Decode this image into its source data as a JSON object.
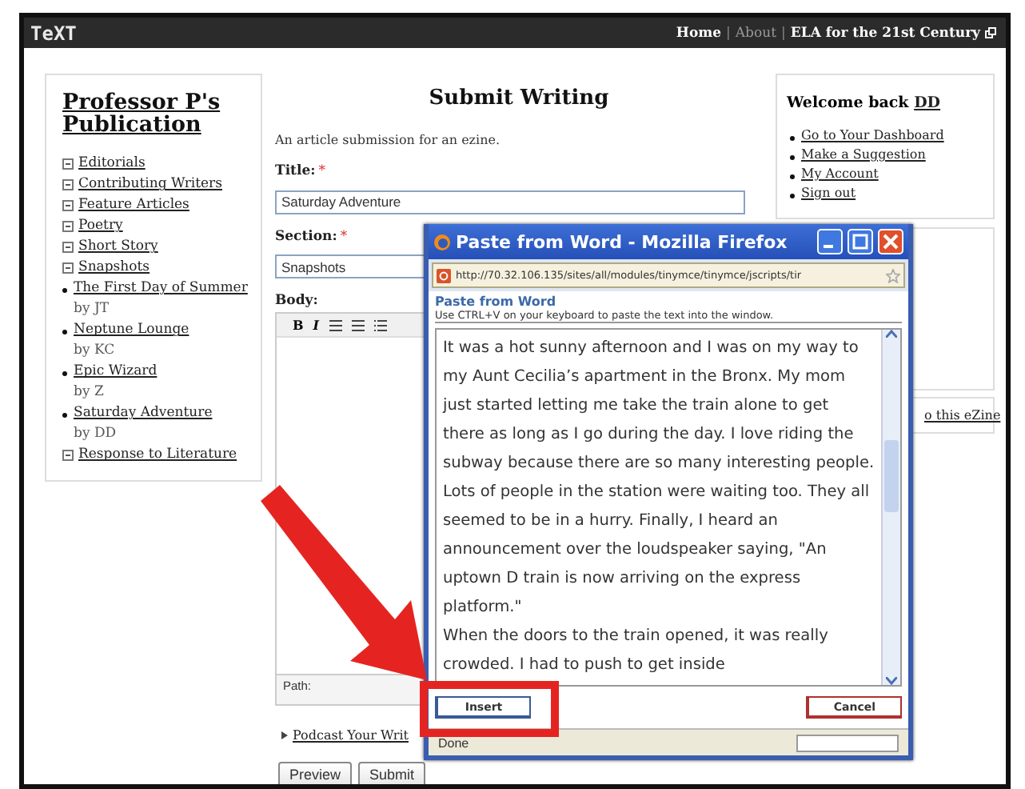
{
  "top_bar": {
    "logo": "TeXT",
    "separators": [
      "|",
      "|"
    ],
    "links": [
      {
        "label": "Home",
        "selected": false
      },
      {
        "label": "About",
        "selected": true
      },
      {
        "label": "ELA for the 21st Century",
        "selected": false,
        "external": true
      }
    ]
  },
  "left_panel": {
    "title": "Professor P's Publication",
    "items": [
      {
        "label": "Editorials"
      },
      {
        "label": "Contributing Writers"
      },
      {
        "label": "Feature Articles"
      },
      {
        "label": "Poetry"
      },
      {
        "label": "Short Story"
      },
      {
        "label": "Snapshots",
        "children": [
          {
            "label": "The First Day of Summer",
            "byline": "by JT"
          },
          {
            "label": "Neptune Lounge",
            "byline": "by KC"
          },
          {
            "label": "Epic Wizard",
            "byline": "by Z"
          },
          {
            "label": "Saturday Adventure",
            "byline": "by DD"
          }
        ]
      },
      {
        "label": "Response to Literature"
      }
    ]
  },
  "main": {
    "heading": "Submit Writing",
    "description": "An article submission for an ezine.",
    "fields": [
      {
        "label": "Title:",
        "required_mark": "*",
        "value": "Saturday Adventure"
      },
      {
        "label": "Section:",
        "required_mark": "*",
        "value": "Snapshots"
      }
    ],
    "body_label": "Body:",
    "format_buttons": [
      "B",
      "I"
    ],
    "path_label": "Path:",
    "podcast_link": "Podcast Your Writ",
    "buttons": [
      "Preview",
      "Submit"
    ]
  },
  "user_panel": {
    "greeting": "Welcome back",
    "user": "DD",
    "links": [
      "Go to Your Dashboard",
      "Make a Suggestion",
      "My Account",
      "Sign out"
    ],
    "side_link": "o this eZine"
  },
  "popup": {
    "title": "Paste from Word - Mozilla Firefox",
    "url": "http://70.32.106.135/sites/all/modules/tinymce/tinymce/jscripts/tir",
    "heading": "Paste from Word",
    "hint": "Use CTRL+V on your keyboard to paste the text into the window.",
    "paragraphs": [
      "It was a hot sunny afternoon and I was on my way to my Aunt Cecilia’s apartment in the Bronx. My mom just started letting me take the train alone to get there as long as I go during the day. I love riding the subway because there are so many interesting people. Lots of people in the station were waiting too. They all seemed to be in a hurry. Finally, I heard an announcement over the loudspeaker saying, \"An uptown D train is now arriving on the express platform.\"",
      "When the doors to the train opened, it was really crowded. I had to push to get inside"
    ],
    "buttons": [
      "Insert",
      "Cancel"
    ],
    "status": "Done"
  }
}
